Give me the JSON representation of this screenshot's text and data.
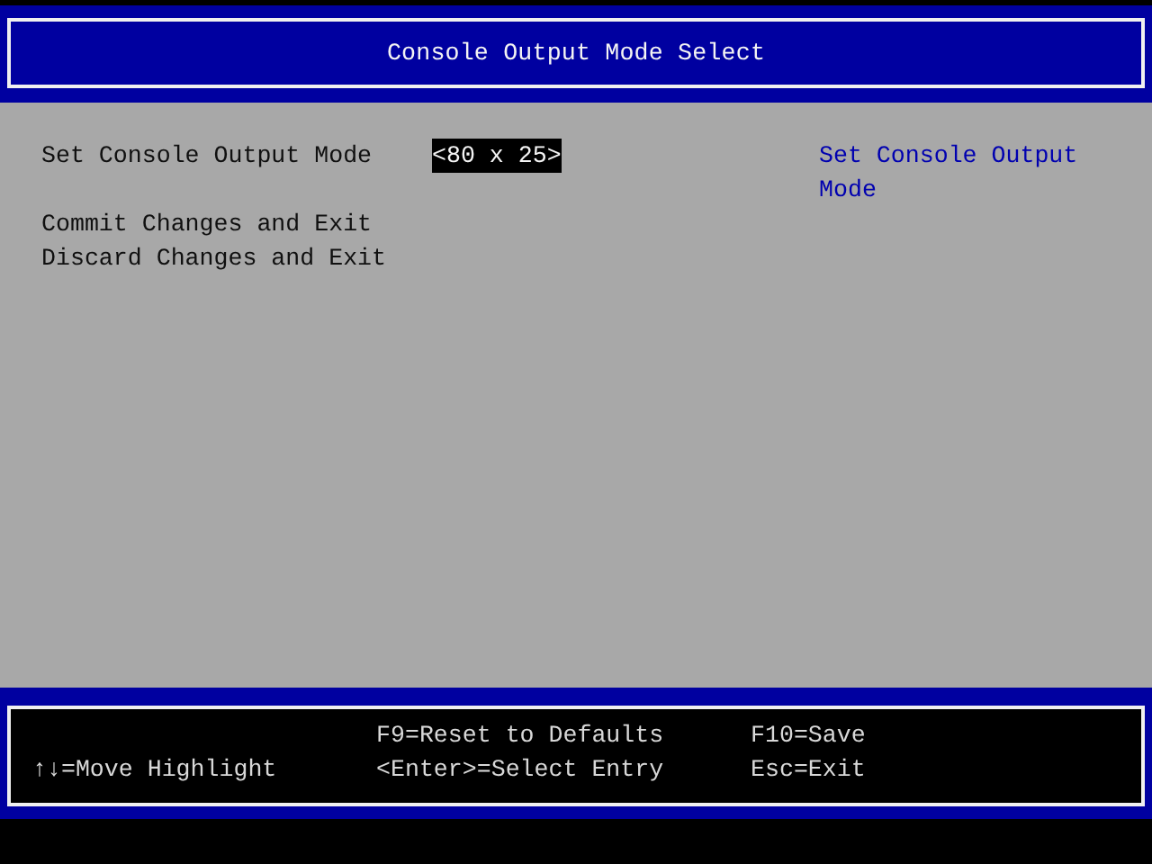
{
  "title": "Console Output Mode Select",
  "items": [
    {
      "kind": "option",
      "label": "Set Console Output Mode",
      "value": "<80 x 25>",
      "selected": true
    },
    {
      "kind": "action",
      "label": "Commit Changes and Exit",
      "selected": false
    },
    {
      "kind": "action",
      "label": "Discard Changes and Exit",
      "selected": false
    }
  ],
  "help": "Set Console Output Mode",
  "key_hints": [
    [
      "↑↓=Move Highlight"
    ],
    [
      "F9=Reset to Defaults",
      "<Enter>=Select Entry"
    ],
    [
      "F10=Save",
      "Esc=Exit"
    ]
  ]
}
